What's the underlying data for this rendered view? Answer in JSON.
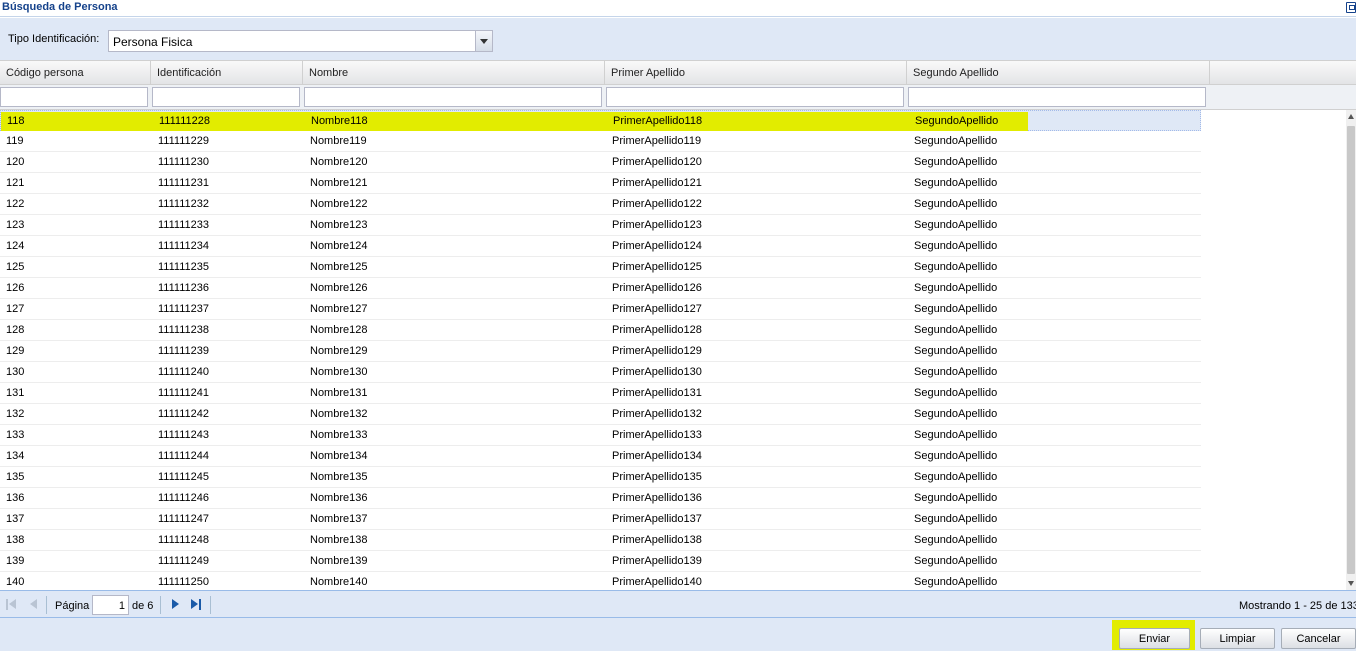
{
  "window": {
    "title": "Búsqueda de Persona"
  },
  "form": {
    "tipo_label": "Tipo Identificación:",
    "tipo_value": "Persona Fisica"
  },
  "grid": {
    "columns": [
      "Código persona",
      "Identificación",
      "Nombre",
      "Primer Apellido",
      "Segundo Apellido"
    ],
    "rows": [
      [
        "118",
        "111111228",
        "Nombre118",
        "PrimerApellido118",
        "SegundoApellido"
      ],
      [
        "119",
        "111111229",
        "Nombre119",
        "PrimerApellido119",
        "SegundoApellido"
      ],
      [
        "120",
        "111111230",
        "Nombre120",
        "PrimerApellido120",
        "SegundoApellido"
      ],
      [
        "121",
        "111111231",
        "Nombre121",
        "PrimerApellido121",
        "SegundoApellido"
      ],
      [
        "122",
        "111111232",
        "Nombre122",
        "PrimerApellido122",
        "SegundoApellido"
      ],
      [
        "123",
        "111111233",
        "Nombre123",
        "PrimerApellido123",
        "SegundoApellido"
      ],
      [
        "124",
        "111111234",
        "Nombre124",
        "PrimerApellido124",
        "SegundoApellido"
      ],
      [
        "125",
        "111111235",
        "Nombre125",
        "PrimerApellido125",
        "SegundoApellido"
      ],
      [
        "126",
        "111111236",
        "Nombre126",
        "PrimerApellido126",
        "SegundoApellido"
      ],
      [
        "127",
        "111111237",
        "Nombre127",
        "PrimerApellido127",
        "SegundoApellido"
      ],
      [
        "128",
        "111111238",
        "Nombre128",
        "PrimerApellido128",
        "SegundoApellido"
      ],
      [
        "129",
        "111111239",
        "Nombre129",
        "PrimerApellido129",
        "SegundoApellido"
      ],
      [
        "130",
        "111111240",
        "Nombre130",
        "PrimerApellido130",
        "SegundoApellido"
      ],
      [
        "131",
        "111111241",
        "Nombre131",
        "PrimerApellido131",
        "SegundoApellido"
      ],
      [
        "132",
        "111111242",
        "Nombre132",
        "PrimerApellido132",
        "SegundoApellido"
      ],
      [
        "133",
        "111111243",
        "Nombre133",
        "PrimerApellido133",
        "SegundoApellido"
      ],
      [
        "134",
        "111111244",
        "Nombre134",
        "PrimerApellido134",
        "SegundoApellido"
      ],
      [
        "135",
        "111111245",
        "Nombre135",
        "PrimerApellido135",
        "SegundoApellido"
      ],
      [
        "136",
        "111111246",
        "Nombre136",
        "PrimerApellido136",
        "SegundoApellido"
      ],
      [
        "137",
        "111111247",
        "Nombre137",
        "PrimerApellido137",
        "SegundoApellido"
      ],
      [
        "138",
        "111111248",
        "Nombre138",
        "PrimerApellido138",
        "SegundoApellido"
      ],
      [
        "139",
        "111111249",
        "Nombre139",
        "PrimerApellido139",
        "SegundoApellido"
      ],
      [
        "140",
        "111111250",
        "Nombre140",
        "PrimerApellido140",
        "SegundoApellido"
      ]
    ],
    "selected_row": 0,
    "highlight_color": "#e2ec00"
  },
  "pager": {
    "page_label": "Página",
    "page_value": "1",
    "of_label": "de 6",
    "info": "Mostrando 1 - 25 de 133"
  },
  "buttons": {
    "send": "Enviar",
    "clear": "Limpiar",
    "cancel": "Cancelar"
  },
  "icons": [
    "restore-icon",
    "dropdown-arrow-icon",
    "first-page-icon",
    "prev-page-icon",
    "next-page-icon",
    "last-page-icon"
  ]
}
